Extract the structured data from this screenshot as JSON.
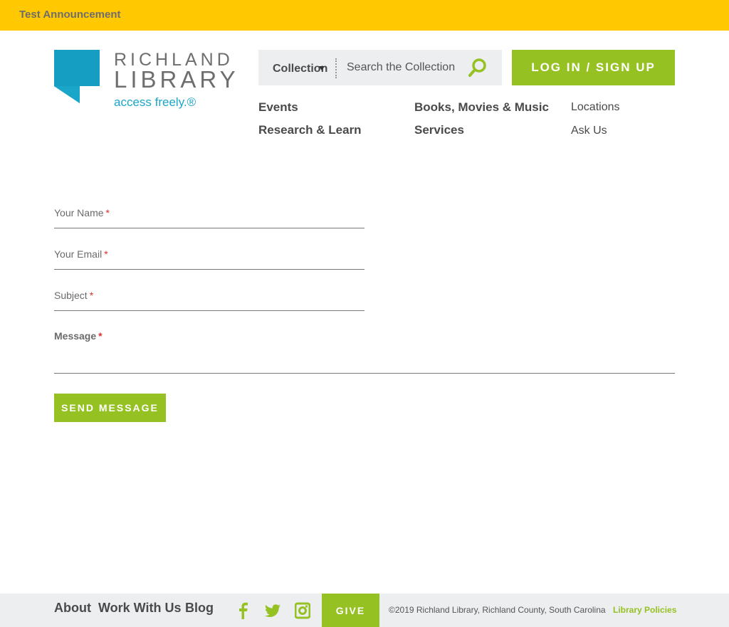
{
  "announcement": {
    "text": "Test Announcement"
  },
  "logo": {
    "line1": "RICHLAND",
    "line2": "LIBRARY",
    "tagline": "access freely.®",
    "brand_blue": "#1aa6c9"
  },
  "search": {
    "scope": "Collection",
    "placeholder": "Search the Collection"
  },
  "login": {
    "label": "LOG IN / SIGN UP"
  },
  "nav": {
    "primary": [
      "Events",
      "Books, Movies & Music",
      "Research & Learn",
      "Services"
    ],
    "secondary": [
      "Locations",
      "Ask Us"
    ]
  },
  "form": {
    "name_label": "Your Name",
    "email_label": "Your Email",
    "subject_label": "Subject",
    "message_label": "Message",
    "required_marker": "*",
    "submit_label": "SEND MESSAGE"
  },
  "footer": {
    "links": [
      "About",
      "Work With Us",
      "Blog"
    ],
    "social": [
      "facebook-icon",
      "twitter-icon",
      "instagram-icon"
    ],
    "give_label": "GIVE",
    "copyright": "©2019 Richland Library, Richland County, South Carolina",
    "policies": "Library Policies"
  },
  "colors": {
    "announcement_bg": "#ffc800",
    "accent_green": "#95c122",
    "text_gray": "#4a4a4a",
    "required_red": "#e0302b"
  }
}
